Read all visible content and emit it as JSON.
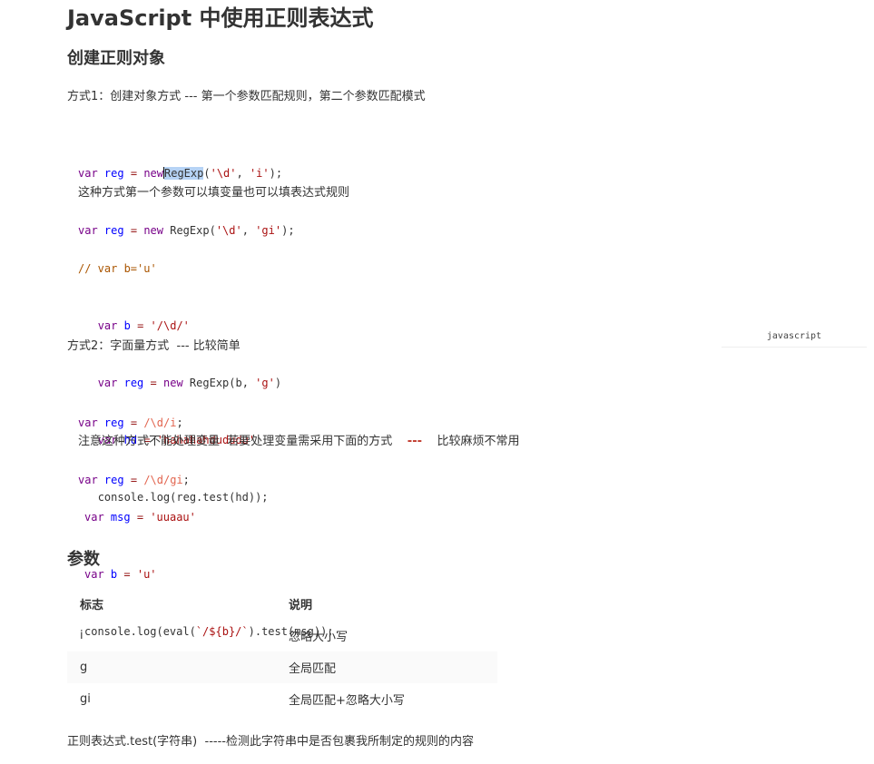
{
  "doc": {
    "title": "JavaScript 中使用正则表达式",
    "section1": "创建正则对象",
    "method1": "方式1：创建对象方式 --- 第一个参数匹配规则，第二个参数匹配模式",
    "code1": {
      "line1": {
        "kw1": "var",
        "var": "reg",
        "op": "=",
        "kw2": "new",
        "ctor": "RegExp",
        "arg1": "'\\d'",
        "arg2": "'i'"
      },
      "line2": {
        "kw1": "var",
        "var": "reg",
        "op": "=",
        "kw2": "new",
        "ctor": "RegExp",
        "arg1": "'\\d'",
        "arg2": "'gi'"
      }
    },
    "note1": "这种方式第一个参数可以填变量也可以填表达式规则",
    "code2": {
      "comment": "// var b='u'",
      "l2_kw": "var",
      "l2_var": "b",
      "l2_val": "'/\\d/'",
      "l3_kw": "var",
      "l3_var": "reg",
      "l3_new": "new",
      "l3_ctor": "RegExp(b, ",
      "l3_arg": "'g'",
      "l3_end": ")",
      "l4_kw": "var",
      "l4_var": "hd",
      "l4_val": "'hahahahdududu'",
      "l5": "console.log(reg.test(hd));"
    },
    "lang_label": "javascript",
    "method2": "方式2：字面量方式  --- 比较简单",
    "code3": {
      "l1_kw": "var",
      "l1_var": "reg",
      "l1_re": "/\\d/i",
      "l2_kw": "var",
      "l2_var": "reg",
      "l2_re": "/\\d/gi"
    },
    "note2_main": "注意这种方式不能处理变量  若要处理变量需采用下面的方式",
    "note2_dash": "---",
    "note2_tail": "比较麻烦不常用",
    "code4": {
      "l1_kw": "var",
      "l1_var": "msg",
      "l1_val": "'uuaau'",
      "l2_kw": "var",
      "l2_var": "b",
      "l2_val": "'u'",
      "l3_pre": "console.log(eval(",
      "l3_str": "`/${b}/`",
      "l3_post": ").test(msg));"
    },
    "section2": "参数",
    "table": {
      "headers": [
        "标志",
        "说明"
      ],
      "rows": [
        [
          "i",
          "忽略大小写"
        ],
        [
          "g",
          "全局匹配"
        ],
        [
          "gi",
          "全局匹配+忽略大小写"
        ]
      ]
    },
    "footer": "正则表达式.test(字符串)  -----检测此字符串中是否包裹我所制定的规则的内容"
  }
}
